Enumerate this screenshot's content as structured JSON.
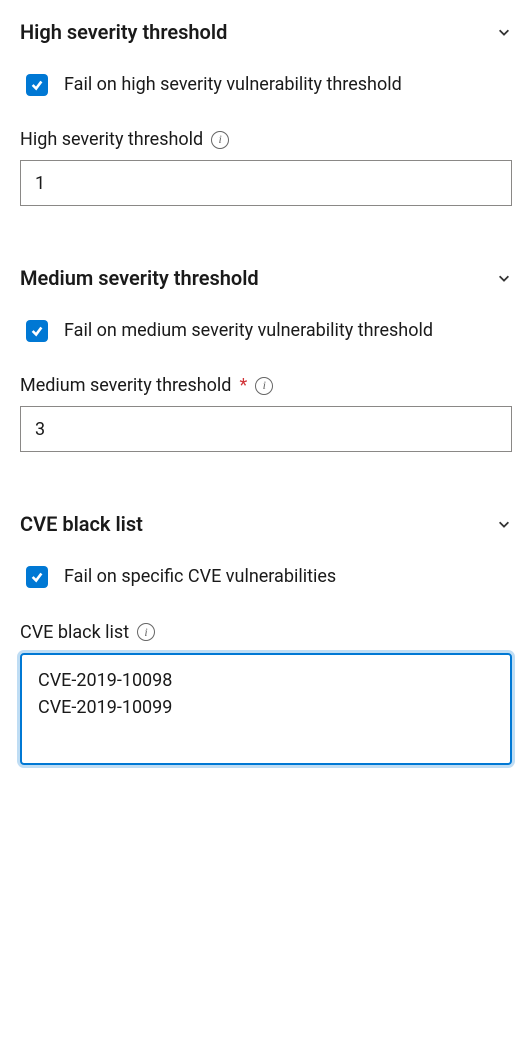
{
  "sections": {
    "high": {
      "title": "High severity threshold",
      "checkbox_label": "Fail on high severity vulnerability threshold",
      "field_label": "High severity threshold",
      "field_value": "1",
      "required": false
    },
    "medium": {
      "title": "Medium severity threshold",
      "checkbox_label": "Fail on medium severity vulnerability threshold",
      "field_label": "Medium severity threshold",
      "field_value": "3",
      "required": true
    },
    "cve": {
      "title": "CVE black list",
      "checkbox_label": "Fail on specific CVE vulnerabilities",
      "field_label": "CVE black list",
      "field_value": "CVE-2019-10098\nCVE-2019-10099"
    }
  }
}
